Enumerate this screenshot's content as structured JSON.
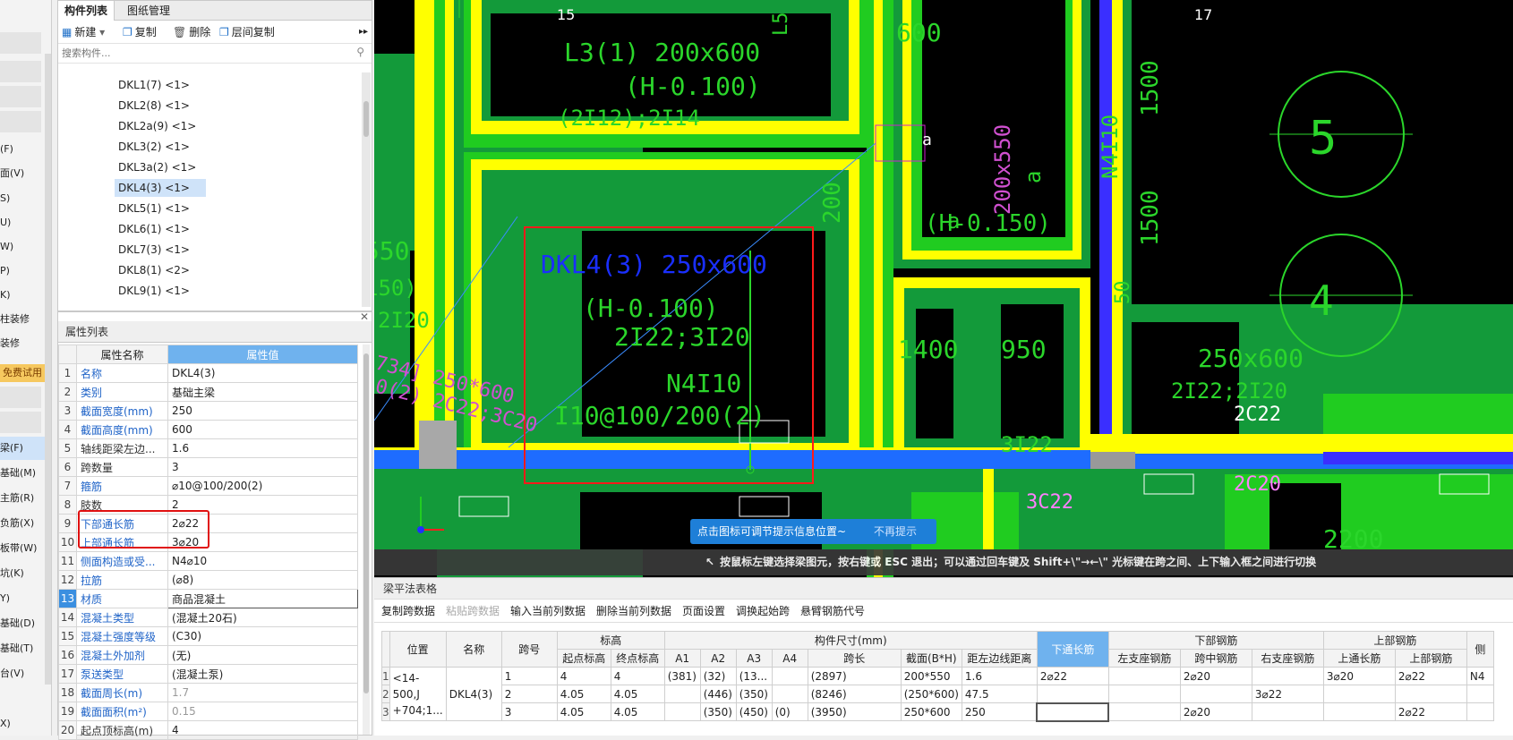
{
  "left_strip": {
    "items": [
      "(F)",
      "面(V)",
      "S)",
      "U)",
      "W)",
      "P)",
      "K)",
      "柱装修",
      "装修",
      "梁(F)",
      "基础(M)",
      "主筋(R)",
      "负筋(X)",
      "板带(W)",
      "坑(K)",
      "Y)",
      "基础(D)",
      "基础(T)",
      "台(V)",
      "X)"
    ],
    "trial_label": "免费试用"
  },
  "component_panel": {
    "tabs": [
      "构件列表",
      "图纸管理"
    ],
    "toolbar": {
      "new": "新建",
      "copy": "复制",
      "delete": "删除",
      "floor_copy": "层间复制",
      "more": "▸▸"
    },
    "search_placeholder": "搜索构件...",
    "items": [
      "DKL1(7) <1>",
      "DKL2(8) <1>",
      "DKL2a(9) <1>",
      "DKL3(2) <1>",
      "DKL3a(2) <1>",
      "DKL4(3) <1>",
      "DKL5(1) <1>",
      "DKL6(1) <1>",
      "DKL7(3) <1>",
      "DKL8(1) <2>",
      "DKL9(1) <1>"
    ],
    "selected_index": 5
  },
  "property_panel": {
    "title": "属性列表",
    "col_name": "属性名称",
    "col_value": "属性值",
    "rows": [
      {
        "n": "1",
        "k": "名称",
        "v": "DKL4(3)"
      },
      {
        "n": "2",
        "k": "类别",
        "v": "基础主梁"
      },
      {
        "n": "3",
        "k": "截面宽度(mm)",
        "v": "250"
      },
      {
        "n": "4",
        "k": "截面高度(mm)",
        "v": "600"
      },
      {
        "n": "5",
        "k": "轴线距梁左边...",
        "v": "1.6"
      },
      {
        "n": "6",
        "k": "跨数量",
        "v": "3"
      },
      {
        "n": "7",
        "k": "箍筋",
        "v": "⌀10@100/200(2)"
      },
      {
        "n": "8",
        "k": "肢数",
        "v": "2"
      },
      {
        "n": "9",
        "k": "下部通长筋",
        "v": "2⌀22"
      },
      {
        "n": "10",
        "k": "上部通长筋",
        "v": "3⌀20"
      },
      {
        "n": "11",
        "k": "侧面构造或受...",
        "v": "N4⌀10"
      },
      {
        "n": "12",
        "k": "拉筋",
        "v": "(⌀8)"
      },
      {
        "n": "13",
        "k": "材质",
        "v": "商品混凝土"
      },
      {
        "n": "14",
        "k": "混凝土类型",
        "v": "(混凝土20石)"
      },
      {
        "n": "15",
        "k": "混凝土强度等级",
        "v": "(C30)"
      },
      {
        "n": "16",
        "k": "混凝土外加剂",
        "v": "(无)"
      },
      {
        "n": "17",
        "k": "泵送类型",
        "v": "(混凝土泵)"
      },
      {
        "n": "18",
        "k": "截面周长(m)",
        "v": "1.7"
      },
      {
        "n": "19",
        "k": "截面面积(m²)",
        "v": "0.15"
      },
      {
        "n": "20",
        "k": "起点顶标高(m)",
        "v": "4"
      }
    ]
  },
  "canvas": {
    "axis_labels": [
      "15",
      "17"
    ],
    "beam_label": {
      "name": "DKL4(3) 250x600",
      "elev": "(H-0.100)",
      "bars": "2I22;3I20",
      "side": "N4I10",
      "stirrup": "I10@100/200(2)"
    },
    "other_labels": [
      "L3(1) 200x600",
      "(H-0.100)",
      "(2I12);2I14",
      "600",
      "200",
      "1400",
      "950",
      "3I22",
      "250x600",
      "2I22;2I20",
      "2C22",
      "2C20",
      "3C22",
      "2200",
      "1500",
      "1500",
      "5",
      "4",
      "x550",
      "150)",
      "2I20",
      "734] 250*600",
      "0(2) 2C22;3C20",
      "200x550",
      "(H-0.150)",
      "a",
      "a",
      "N4I10",
      "L5",
      "50"
    ],
    "hint": {
      "text": "点击图标可调节提示信息位置~",
      "dismiss": "不再提示"
    },
    "status": "按鼠标左键选择梁图元，按右键或 ESC 退出；可以通过回车键及 Shift+\\\"→←\\\" 光标键在跨之间、上下输入框之间进行切换"
  },
  "beam_table": {
    "title": "梁平法表格",
    "buttons": [
      "复制跨数据",
      "粘贴跨数据",
      "输入当前列数据",
      "删除当前列数据",
      "页面设置",
      "调换起始跨",
      "悬臂钢筋代号"
    ],
    "disabled_button": 1,
    "headers_top": [
      "位置",
      "名称",
      "跨号",
      "标高",
      "构件尺寸(mm)",
      "下通长筋",
      "下部钢筋",
      "上部钢筋",
      "侧"
    ],
    "headers_sub": [
      "起点标高",
      "终点标高",
      "A1",
      "A2",
      "A3",
      "A4",
      "跨长",
      "截面(B*H)",
      "距左边线距离",
      "左支座钢筋",
      "跨中钢筋",
      "右支座钢筋",
      "上通长筋",
      "上部钢筋"
    ],
    "position": "<14-500,J +704;1...",
    "name": "DKL4(3)",
    "rows": [
      {
        "rn": "1",
        "span": "1",
        "start": "4",
        "end": "4",
        "a1": "(381)",
        "a2": "(32)",
        "a3": "(13...",
        "a4": "",
        "len": "(2897)",
        "sec": "200*550",
        "dist": "1.6",
        "bot": "2⌀22",
        "lsup": "",
        "mid": "2⌀20",
        "rsup": "",
        "top": "3⌀20",
        "topbar": "2⌀22",
        "side": "N4"
      },
      {
        "rn": "2",
        "span": "2",
        "start": "4.05",
        "end": "4.05",
        "a1": "",
        "a2": "(446)",
        "a3": "(350)",
        "a4": "",
        "len": "(8246)",
        "sec": "(250*600)",
        "dist": "47.5",
        "bot": "",
        "lsup": "",
        "mid": "",
        "rsup": "3⌀22",
        "top": "",
        "topbar": "",
        "side": ""
      },
      {
        "rn": "3",
        "span": "3",
        "start": "4.05",
        "end": "4.05",
        "a1": "",
        "a2": "(350)",
        "a3": "(450)",
        "a4": "(0)",
        "len": "(3950)",
        "sec": "250*600",
        "dist": "250",
        "bot": "",
        "lsup": "",
        "mid": "2⌀20",
        "rsup": "",
        "top": "",
        "topbar": "2⌀22",
        "side": ""
      }
    ]
  }
}
